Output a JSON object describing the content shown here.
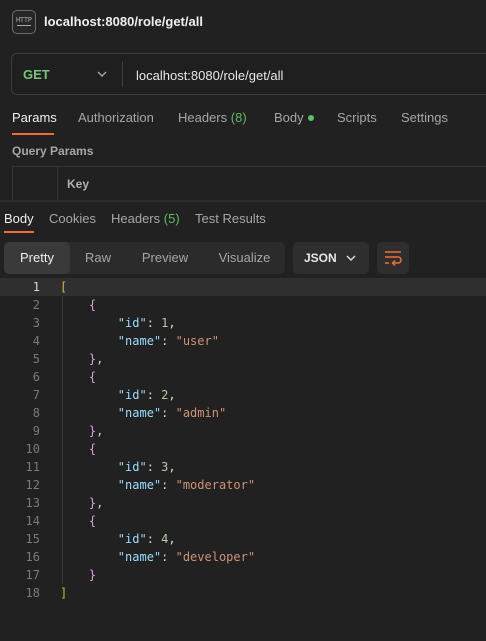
{
  "window": {
    "title": "localhost:8080/role/get/all",
    "icon_text": "HTTP"
  },
  "request": {
    "method": "GET",
    "url": "localhost:8080/role/get/all"
  },
  "request_tabs": [
    {
      "label": "Params"
    },
    {
      "label": "Authorization"
    },
    {
      "label": "Headers",
      "count": "(8)"
    },
    {
      "label": "Body"
    },
    {
      "label": "Scripts"
    },
    {
      "label": "Settings"
    }
  ],
  "query_params": {
    "label": "Query Params",
    "column_key": "Key"
  },
  "response_tabs": [
    {
      "label": "Body"
    },
    {
      "label": "Cookies"
    },
    {
      "label": "Headers",
      "count": "(5)"
    },
    {
      "label": "Test Results"
    }
  ],
  "view_modes": [
    "Pretty",
    "Raw",
    "Preview",
    "Visualize"
  ],
  "format": "JSON",
  "response_body": [
    {
      "id": 1,
      "name": "user"
    },
    {
      "id": 2,
      "name": "admin"
    },
    {
      "id": 3,
      "name": "moderator"
    },
    {
      "id": 4,
      "name": "developer"
    }
  ],
  "colors": {
    "accent": "#f26b3a",
    "method_get": "#79c47a",
    "count": "#61b868",
    "json_key": "#9cdcfe",
    "json_number": "#b5cea8",
    "json_string": "#ce9178"
  }
}
